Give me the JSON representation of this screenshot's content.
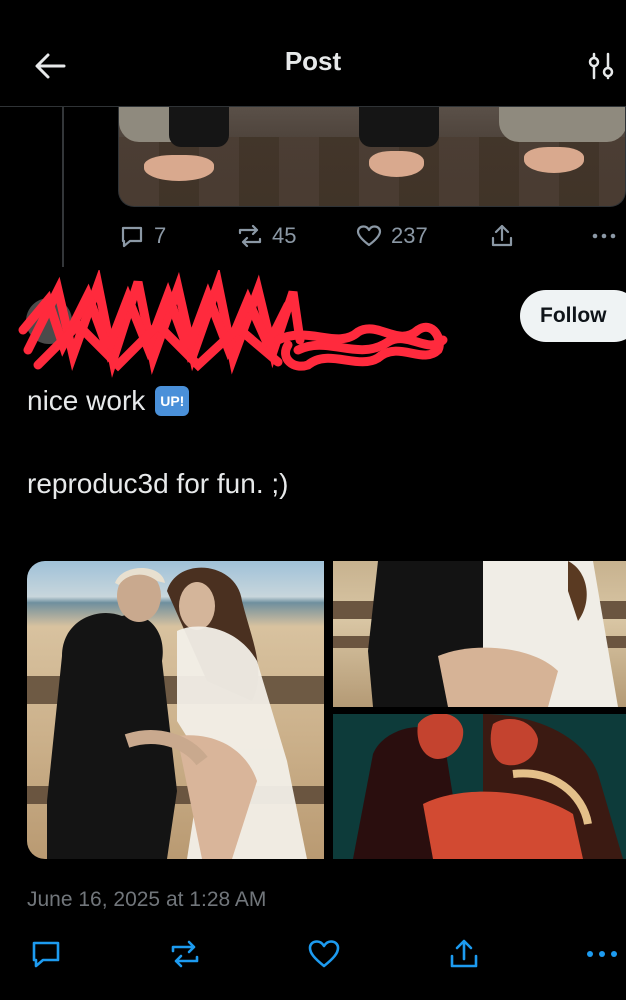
{
  "header": {
    "title": "Post"
  },
  "quoted_post": {
    "actions": {
      "replies": "7",
      "reposts": "45",
      "likes": "237"
    }
  },
  "reply": {
    "follow_label": "Follow",
    "text_line1": "nice work",
    "emoji_label": "UP!",
    "text_line2": "reproduc3d for fun. ;)",
    "timestamp": "June 16, 2025 at 1:28 AM"
  },
  "colors": {
    "background": "#000000",
    "text_primary": "#e7e9ea",
    "text_secondary": "#71767b",
    "icon_gray": "#8b98a5",
    "follow_button_bg": "#eff3f4",
    "redaction_red": "#ff2a3d"
  },
  "icons": {
    "back": "arrow-left-icon",
    "settings": "sliders-icon",
    "reply": "speech-bubble-icon",
    "repost": "repost-arrows-icon",
    "like": "heart-icon",
    "share": "share-upload-icon",
    "more": "more-dots-icon"
  }
}
